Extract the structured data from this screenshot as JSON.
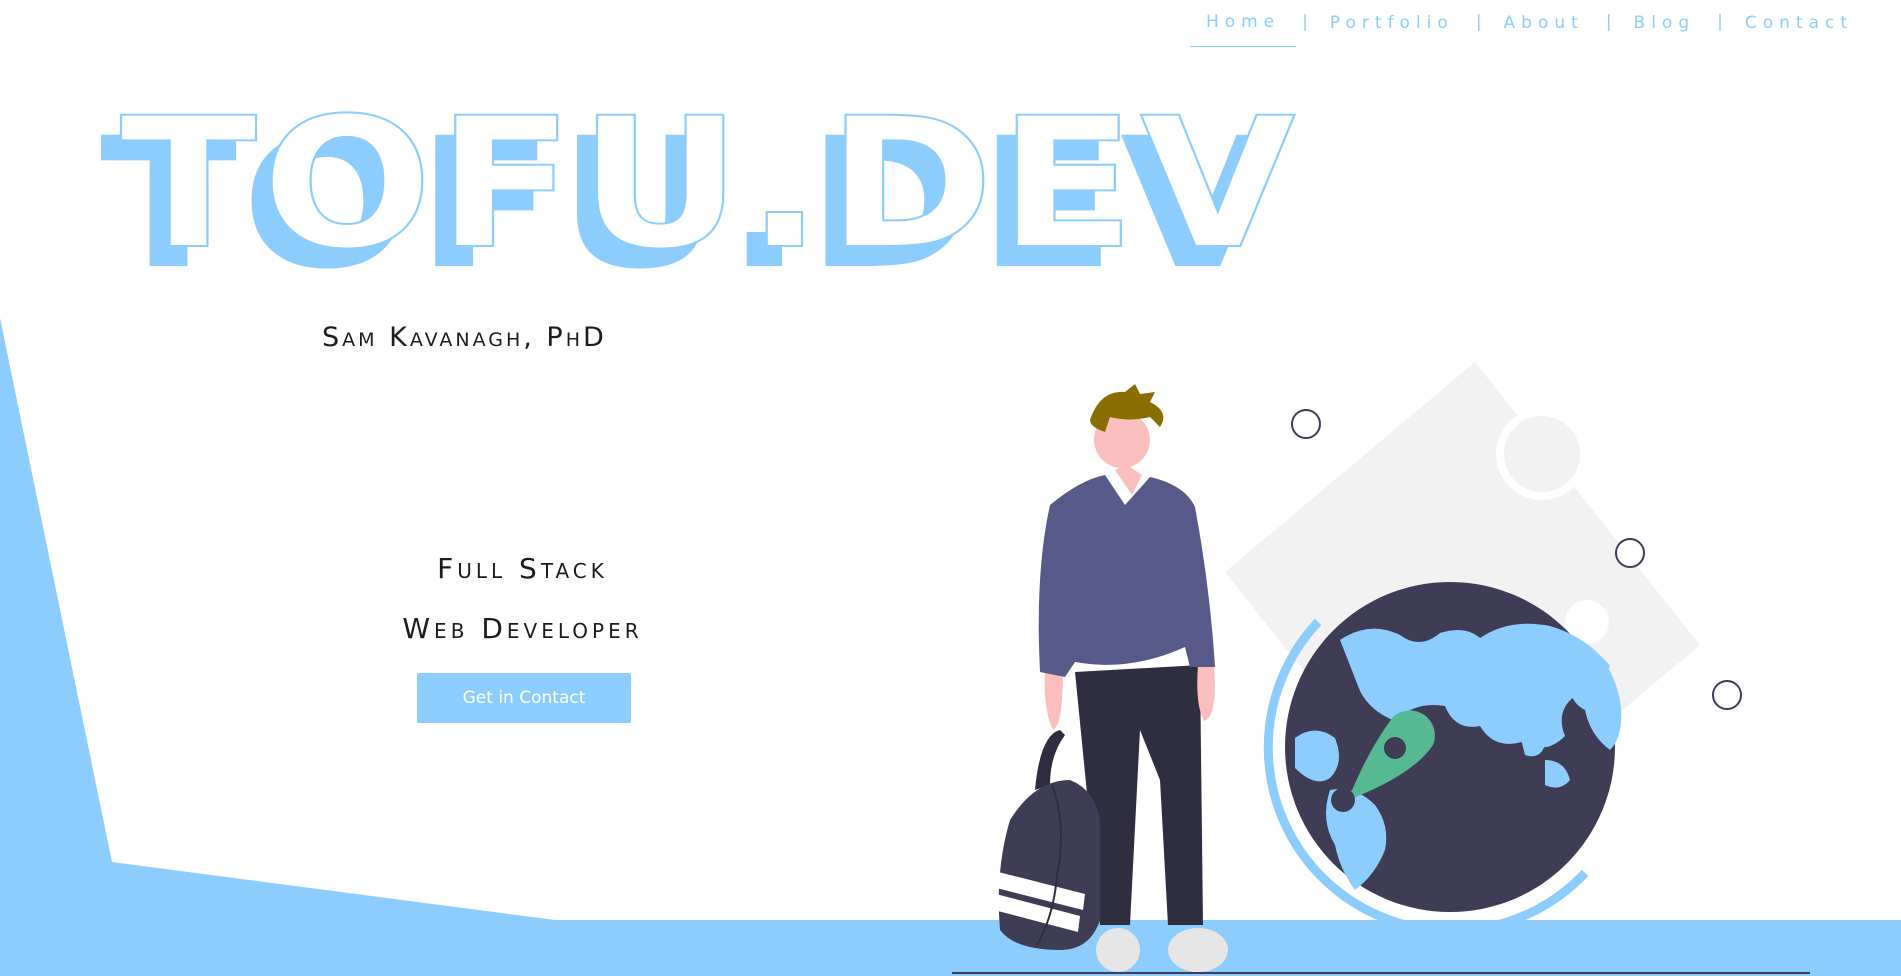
{
  "nav": {
    "items": [
      {
        "label": "Home",
        "active": true
      },
      {
        "label": "Portfolio"
      },
      {
        "label": "About"
      },
      {
        "label": "Blog"
      },
      {
        "label": "Contact"
      }
    ],
    "separator": "|"
  },
  "hero": {
    "logo_text": "TOFU.DEV",
    "subtitle": "Sam Kavanagh, PhD",
    "role_line1": "Full Stack",
    "role_line2": "Web Developer",
    "cta_label": "Get in Contact"
  },
  "colors": {
    "accent": "#8ccdfd",
    "dark": "#3f3d56",
    "shirt": "#575a89",
    "skin": "#fbbebe",
    "hair": "#8b6e00",
    "pin": "#57b894",
    "deco_gray": "#f2f2f2"
  },
  "icons": [
    "person-illustration",
    "backpack-icon",
    "globe-icon",
    "map-pin-icon"
  ]
}
